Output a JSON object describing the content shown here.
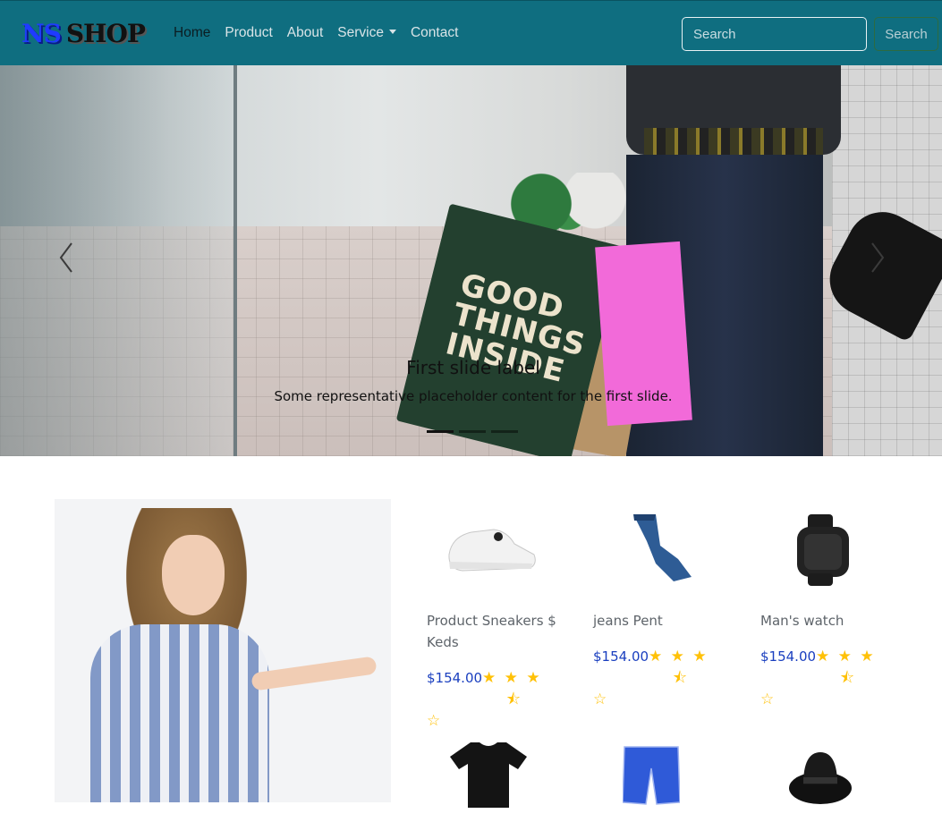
{
  "navbar": {
    "brand_ns": "NS",
    "brand_shop": "SHOP",
    "links": [
      {
        "label": "Home",
        "active": true
      },
      {
        "label": "Product",
        "active": false
      },
      {
        "label": "About",
        "active": false
      },
      {
        "label": "Service",
        "active": false,
        "dropdown": true
      },
      {
        "label": "Contact",
        "active": false
      }
    ],
    "search_placeholder": "Search",
    "search_button": "Search",
    "background_color": "#0f6e80"
  },
  "carousel": {
    "caption_title": "First slide label",
    "caption_text": "Some representative placeholder content for the first slide.",
    "indicator_count": 3,
    "active_indicator": 0,
    "bag_text": "GOOD THINGS INSIDE"
  },
  "products": [
    {
      "name": "Product Sneakers $ Keds",
      "price": "$154.00",
      "rating": 3.5,
      "icon": "sneaker-icon"
    },
    {
      "name": "jeans Pent",
      "price": "$154.00",
      "rating": 3.5,
      "icon": "jeans-icon"
    },
    {
      "name": "Man's watch",
      "price": "$154.00",
      "rating": 3.5,
      "icon": "watch-icon"
    },
    {
      "icon": "tshirt-icon"
    },
    {
      "icon": "shorts-icon"
    },
    {
      "icon": "hat-icon"
    }
  ],
  "colors": {
    "price": "#1a3fbf",
    "star": "#ffc107",
    "accent": "#0f6e80"
  }
}
